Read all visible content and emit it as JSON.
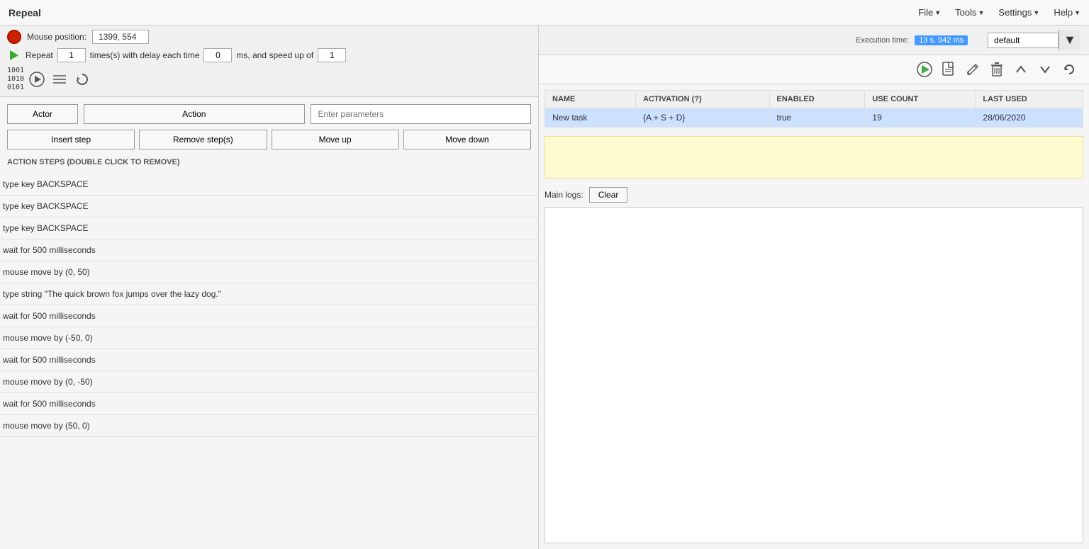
{
  "app": {
    "title": "Repeal"
  },
  "menubar": {
    "items": [
      {
        "label": "File",
        "has_arrow": true
      },
      {
        "label": "Tools",
        "has_arrow": true
      },
      {
        "label": "Settings",
        "has_arrow": true
      },
      {
        "label": "Help",
        "has_arrow": true
      }
    ]
  },
  "controls": {
    "mouse_position_label": "Mouse position:",
    "mouse_position_value": "1399, 554",
    "repeat_label": "Repeat",
    "repeat_value": "1",
    "times_label": "times(s) with delay each time",
    "delay_value": "0",
    "ms_label": "ms, and speed up of",
    "speedup_value": "1"
  },
  "profile": {
    "selected": "default",
    "options": [
      "default"
    ]
  },
  "execution": {
    "label": "Execution time:",
    "value": "13 s, 942 ms",
    "color": "#4499ff"
  },
  "action_editor": {
    "actor_label": "Actor",
    "action_label": "Action",
    "params_placeholder": "Enter parameters",
    "insert_step_label": "Insert step",
    "remove_steps_label": "Remove step(s)",
    "move_up_label": "Move up",
    "move_down_label": "Move down",
    "steps_section_label": "ACTION STEPS (DOUBLE CLICK TO REMOVE)"
  },
  "steps": [
    {
      "text": "type key BACKSPACE"
    },
    {
      "text": "type key BACKSPACE"
    },
    {
      "text": "type key BACKSPACE"
    },
    {
      "text": "wait for 500 milliseconds"
    },
    {
      "text": "mouse move by (0, 50)"
    },
    {
      "text": "type string \"The quick brown fox jumps over the lazy dog.\""
    },
    {
      "text": "wait for 500 milliseconds"
    },
    {
      "text": "mouse move by (-50, 0)"
    },
    {
      "text": "wait for 500 milliseconds"
    },
    {
      "text": "mouse move by (0, -50)"
    },
    {
      "text": "wait for 500 milliseconds"
    },
    {
      "text": "mouse move by (50, 0)"
    }
  ],
  "tasks_table": {
    "columns": [
      "NAME",
      "ACTIVATION (?)",
      "ENABLED",
      "USE COUNT",
      "LAST USED"
    ],
    "rows": [
      {
        "name": "New task",
        "activation": "{A + S + D}",
        "enabled": "true",
        "use_count": "19",
        "last_used": "28/06/2020",
        "selected": true
      }
    ]
  },
  "logs": {
    "label": "Main logs:",
    "clear_button": "Clear"
  },
  "toolbar_icons": {
    "play": "▶",
    "new": "📄",
    "edit": "✏️",
    "delete": "🗑",
    "up": "⌃",
    "down": "⌄",
    "refresh": "↻"
  }
}
